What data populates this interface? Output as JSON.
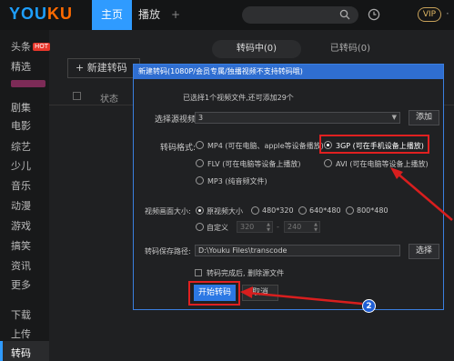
{
  "header": {
    "logo_you": "YOU",
    "logo_ku": "KU",
    "tabs": [
      "主页",
      "播放",
      "+"
    ],
    "vip": "VIP",
    "more": "·"
  },
  "sidebar": {
    "items": [
      "头条",
      "精选",
      "剧集",
      "电影",
      "综艺",
      "少儿",
      "音乐",
      "动漫",
      "游戏",
      "搞笑",
      "资讯",
      "更多",
      "下载",
      "上传",
      "转码"
    ],
    "hot_badge": "HOT"
  },
  "page": {
    "seg_transcoding": "转码中(0)",
    "seg_done": "已转码(0)",
    "new_button": "新建转码",
    "col_status": "状态"
  },
  "dialog": {
    "title": "新建转码(1080P/会员专属/独播视频不支持转码哦)",
    "selected_info": "已选择1个视频文件,还可添加29个",
    "source_label": "选择源视频:",
    "source_value": "3",
    "add_button": "添加",
    "format_label": "转码格式:",
    "formats": [
      "MP4 (可在电脑、apple等设备播放)",
      "3GP (可在手机设备上播放)",
      "FLV (可在电脑等设备上播放)",
      "AVI (可在电脑等设备上播放)",
      "MP3 (纯音频文件)"
    ],
    "selected_format": "3GP",
    "size_label": "视频画面大小:",
    "sizes": [
      "原视频大小",
      "480*320",
      "640*480",
      "800*480"
    ],
    "custom_label": "自定义",
    "custom_w": "320",
    "custom_h": "240",
    "path_label": "转码保存路径:",
    "path_value": "D:\\Youku Files\\transcode",
    "browse_button": "选择",
    "delete_source": "转码完成后, 删除源文件",
    "start_button": "开始转码",
    "cancel_button": "取消",
    "step_badge": "2"
  }
}
